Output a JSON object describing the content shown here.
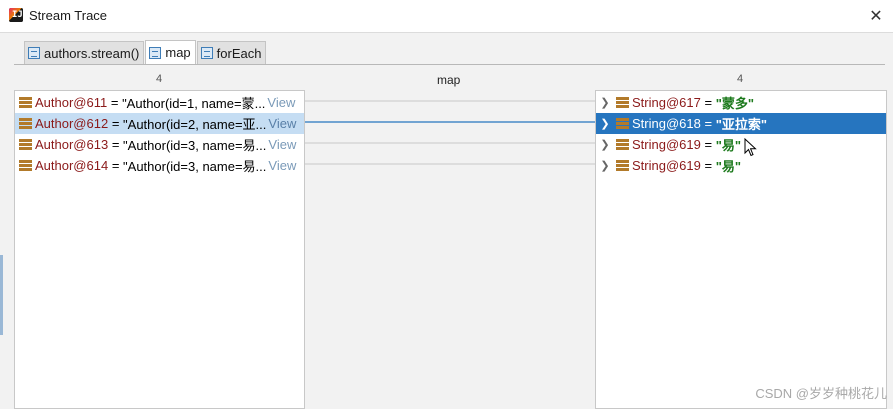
{
  "window": {
    "title": "Stream Trace",
    "close_glyph": "✕"
  },
  "tabs": [
    {
      "label": "authors.stream()",
      "active": false
    },
    {
      "label": "map",
      "active": true
    },
    {
      "label": "forEach",
      "active": false
    }
  ],
  "columns": {
    "left_count": "4",
    "middle_label": "map",
    "right_count": "4"
  },
  "left_items": [
    {
      "ref": "Author@611",
      "eq": " = ",
      "value": "\"Author(id=1, name=蒙...",
      "link": "View",
      "selected": false
    },
    {
      "ref": "Author@612",
      "eq": " = ",
      "value": "\"Author(id=2, name=亚...",
      "link": "View",
      "selected": true
    },
    {
      "ref": "Author@613",
      "eq": " = ",
      "value": "\"Author(id=3, name=易...",
      "link": "View",
      "selected": false
    },
    {
      "ref": "Author@614",
      "eq": " = ",
      "value": "\"Author(id=3, name=易...",
      "link": "View",
      "selected": false
    }
  ],
  "right_items": [
    {
      "ref": "String@617",
      "eq": " = ",
      "value": "\"蒙多\"",
      "selected": false
    },
    {
      "ref": "String@618",
      "eq": " = ",
      "value": "\"亚拉索\"",
      "selected": true
    },
    {
      "ref": "String@619",
      "eq": " = ",
      "value": "\"易\"",
      "selected": false
    },
    {
      "ref": "String@619",
      "eq": " = ",
      "value": "\"易\"",
      "selected": false
    }
  ],
  "links": [
    {
      "from": 0,
      "to": 0,
      "highlighted": false
    },
    {
      "from": 1,
      "to": 1,
      "highlighted": true
    },
    {
      "from": 2,
      "to": 2,
      "highlighted": false
    },
    {
      "from": 3,
      "to": 3,
      "highlighted": false
    }
  ],
  "watermark": "CSDN @岁岁种桃花儿",
  "colors": {
    "selection_left": "#c5ddf3",
    "selection_right": "#2675bf",
    "link_line": "#c8c8c8",
    "link_highlight": "#2675bf",
    "reference_text": "#8b1a1a",
    "string_value": "#1d7a1d"
  },
  "icons": {
    "app": "intellij-idea-icon",
    "tab": "stream-step-icon",
    "item": "field-value-icon",
    "expand": "chevron-right-icon",
    "close": "close-icon"
  }
}
